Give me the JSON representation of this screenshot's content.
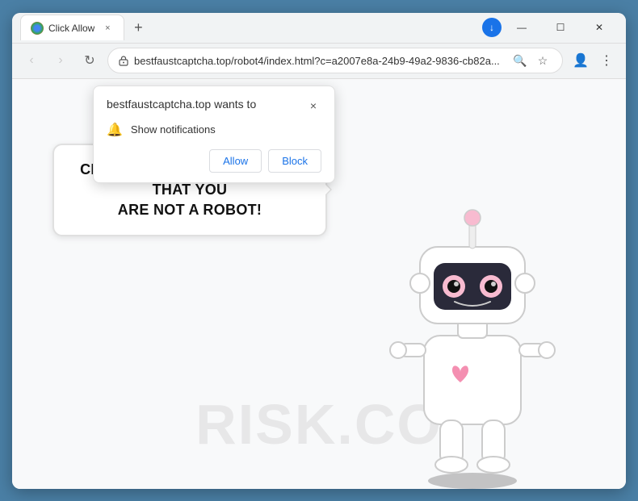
{
  "browser": {
    "tab": {
      "title": "Click Allow",
      "favicon_label": "globe-icon"
    },
    "address_bar": {
      "url": "bestfaustcaptcha.top/robot4/index.html?c=a2007e8a-24b9-49a2-9836-cb82a...",
      "lock_icon": "lock-icon"
    },
    "nav": {
      "back": "‹",
      "forward": "›",
      "reload": "↻"
    }
  },
  "notification_popup": {
    "site_text": "bestfaustcaptcha.top wants to",
    "close_label": "×",
    "notification_row_label": "Show notifications",
    "bell_icon": "bell-icon",
    "allow_btn": "Allow",
    "block_btn": "Block"
  },
  "page": {
    "speech_bubble_line1": "CLICK «ALLOW» TO CONFIRM THAT YOU",
    "speech_bubble_line2": "ARE NOT A ROBOT!",
    "watermark": "RISK.CO",
    "robot_shadow": "robot-shadow"
  },
  "window_controls": {
    "minimize": "—",
    "maximize": "☐",
    "close": "✕"
  }
}
